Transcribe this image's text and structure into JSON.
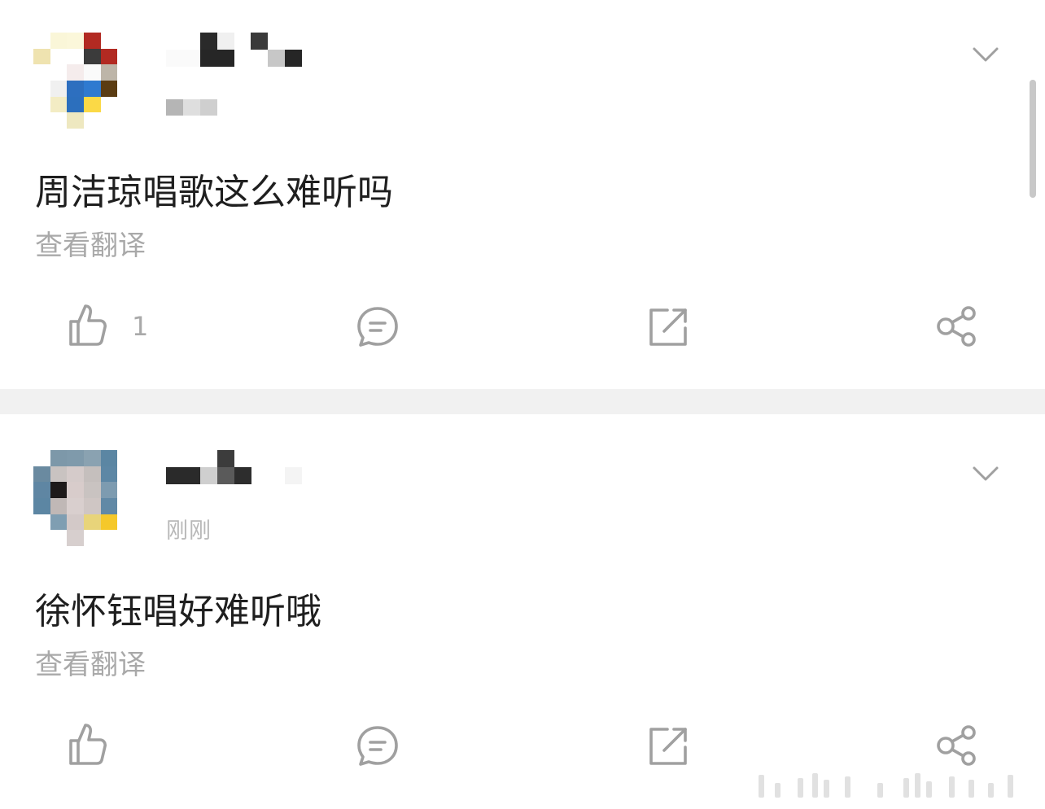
{
  "posts": [
    {
      "body": "周洁琼唱歌这么难听吗",
      "translate_label": "查看翻译",
      "like_count": "1",
      "icons": {
        "more": "chevron-down-icon",
        "like": "thumbs-up-icon",
        "comment": "comment-bubble-icon",
        "repost": "repost-icon",
        "share": "share-icon"
      }
    },
    {
      "timestamp": "刚刚",
      "body": "徐怀钰唱好难听哦",
      "translate_label": "查看翻译",
      "icons": {
        "more": "chevron-down-icon",
        "like": "thumbs-up-icon",
        "comment": "comment-bubble-icon",
        "repost": "repost-icon",
        "share": "share-icon"
      }
    }
  ],
  "colors": {
    "text_primary": "#1f1f1f",
    "text_secondary": "#a9a9a9",
    "icon": "#a0a0a0",
    "separator": "#f1f1f1"
  }
}
